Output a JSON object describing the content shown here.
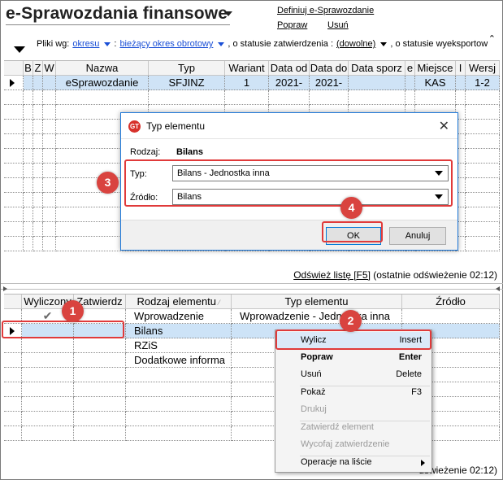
{
  "app": {
    "title": "e-Sprawozdania finansowe",
    "links": {
      "define": "Definiuj e-Sprawozdanie",
      "edit": "Popraw",
      "delete": "Usuń"
    },
    "clip_mark": "⌃"
  },
  "filters": {
    "prefix": "Pliki wg:",
    "period_mode": "okresu",
    "colon": ":",
    "period_value": "bieżący okres obrotowy",
    "approval_label": ", o statusie zatwierdzenia :",
    "approval_value": "(dowolne)",
    "export_label": ", o statusie wyeksportow"
  },
  "top_grid": {
    "columns": [
      "B",
      "Z",
      "W",
      "Nazwa",
      "Typ",
      "Wariant",
      "Data od",
      "Data do",
      "Data sporz",
      "e",
      "Miejsce",
      "I",
      "Wersj"
    ],
    "rows": [
      [
        "",
        "",
        "",
        "eSprawozdanie",
        "SFJINZ",
        "1",
        "2021-",
        "2021-",
        "",
        "",
        "KAS",
        "",
        "1-2"
      ]
    ]
  },
  "status_top": {
    "link": "Odśwież listę [F5]",
    "text": " (ostatnie odświeżenie 02:12)"
  },
  "status_bottom": {
    "text": "dświeżenie 02:12)"
  },
  "bottom_grid": {
    "columns": [
      "Wyliczony",
      "Zatwierdz",
      "Rodzaj elementu",
      "Typ elementu",
      "Źródło"
    ],
    "rows": [
      {
        "calculated": "✔",
        "approved": "",
        "kind": "Wprowadzenie",
        "type": "Wprowadzenie - Jednostka inna",
        "source": ""
      },
      {
        "calculated": "",
        "approved": "",
        "kind": "Bilans",
        "type": "",
        "source": ""
      },
      {
        "calculated": "",
        "approved": "",
        "kind": "RZiS",
        "type": "",
        "source": ""
      },
      {
        "calculated": "",
        "approved": "",
        "kind": "Dodatkowe informa",
        "type": "",
        "source": ""
      }
    ]
  },
  "dialog": {
    "title": "Typ elementu",
    "icon_text": "GT",
    "close_glyph": "✕",
    "kind_label": "Rodzaj:",
    "kind_value": "Bilans",
    "type_label": "Typ:",
    "type_value": "Bilans - Jednostka inna",
    "source_label": "Źródło:",
    "source_value": "Bilans",
    "ok_label": "OK",
    "cancel_label": "Anuluj"
  },
  "context_menu": {
    "items": [
      {
        "label": "Wylicz",
        "shortcut": "Insert",
        "state": "highlighted"
      },
      {
        "label": "Popraw",
        "shortcut": "Enter",
        "state": "bold"
      },
      {
        "label": "Usuń",
        "shortcut": "Delete",
        "state": "normal"
      },
      {
        "label": "Pokaż",
        "shortcut": "F3",
        "state": "normal"
      },
      {
        "label": "Drukuj",
        "shortcut": "",
        "state": "disabled"
      },
      {
        "label": "Zatwierdź element",
        "shortcut": "",
        "state": "disabled"
      },
      {
        "label": "Wycofaj zatwierdzenie",
        "shortcut": "",
        "state": "disabled"
      },
      {
        "label": "Operacje na liście",
        "shortcut": "",
        "state": "submenu"
      }
    ]
  },
  "annotations": {
    "markers": [
      "1",
      "2",
      "3",
      "4"
    ],
    "color": "#d9433f"
  },
  "colors": {
    "selection": "#cfe3f6",
    "link_blue": "#1a4fd6",
    "dialog_border": "#1e78d8"
  }
}
